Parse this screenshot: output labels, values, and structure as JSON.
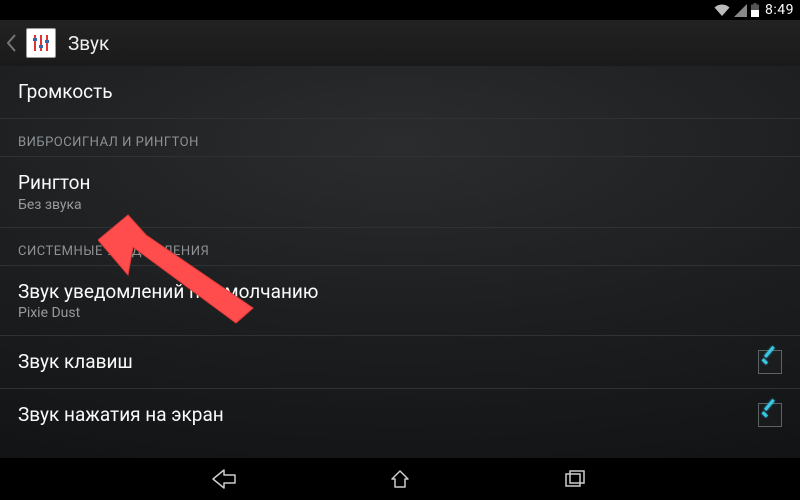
{
  "statusbar": {
    "time": "8:49"
  },
  "appbar": {
    "title": "Звук"
  },
  "settings": {
    "volume_label": "Громкость",
    "section_vibration_ringtone": "ВИБРОСИГНАЛ И РИНГТОН",
    "ringtone": {
      "title": "Рингтон",
      "value": "Без звука"
    },
    "section_system": "СИСТЕМНЫЕ УВЕДОМЛЕНИЯ",
    "default_notification": {
      "title": "Звук уведомлений по умолчанию",
      "value": "Pixie Dust"
    },
    "dialpad_sounds": {
      "title": "Звук клавиш",
      "checked": true
    },
    "touch_sounds": {
      "title": "Звук нажатия на экран",
      "checked": true
    }
  }
}
